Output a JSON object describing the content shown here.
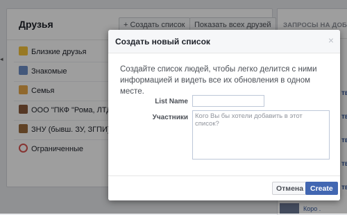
{
  "background": {
    "panel_title": "Друзья",
    "create_list_button": "+ Создать список",
    "show_all_button": "Показать всех друзей",
    "lists": [
      {
        "label": "Близкие друзья",
        "icon": "star-icon"
      },
      {
        "label": "Знакомые",
        "icon": "acquaintances-icon"
      },
      {
        "label": "Семья",
        "icon": "family-icon"
      },
      {
        "label": "ООО \"ПКФ \"Рома, ЛТД\"",
        "icon": "work-icon"
      },
      {
        "label": "ЗНУ (бывш. ЗУ, ЗГПИ)",
        "icon": "school-icon"
      },
      {
        "label": "Ограниченные",
        "icon": "restricted-icon"
      }
    ],
    "right_panel_title": "ЗАПРОСЫ НА ДОБАВ...",
    "right_stub_text": "тв",
    "right_bottom_text": "Коро ."
  },
  "dialog": {
    "title": "Создать новый список",
    "description": "Создайте список людей, чтобы легко делится с ними информацией и видеть все их обновления в одном месте.",
    "list_name_label": "List Name",
    "list_name_value": "",
    "members_label": "Участники",
    "members_placeholder": "Кого Вы бы хотели добавить в этот список?",
    "cancel_label": "Отмена",
    "create_label": "Create",
    "close_symbol": "×"
  },
  "colors": {
    "primary_button": "#4267b2",
    "link": "#365899",
    "overlay": "rgba(0,0,0,0.38)"
  }
}
